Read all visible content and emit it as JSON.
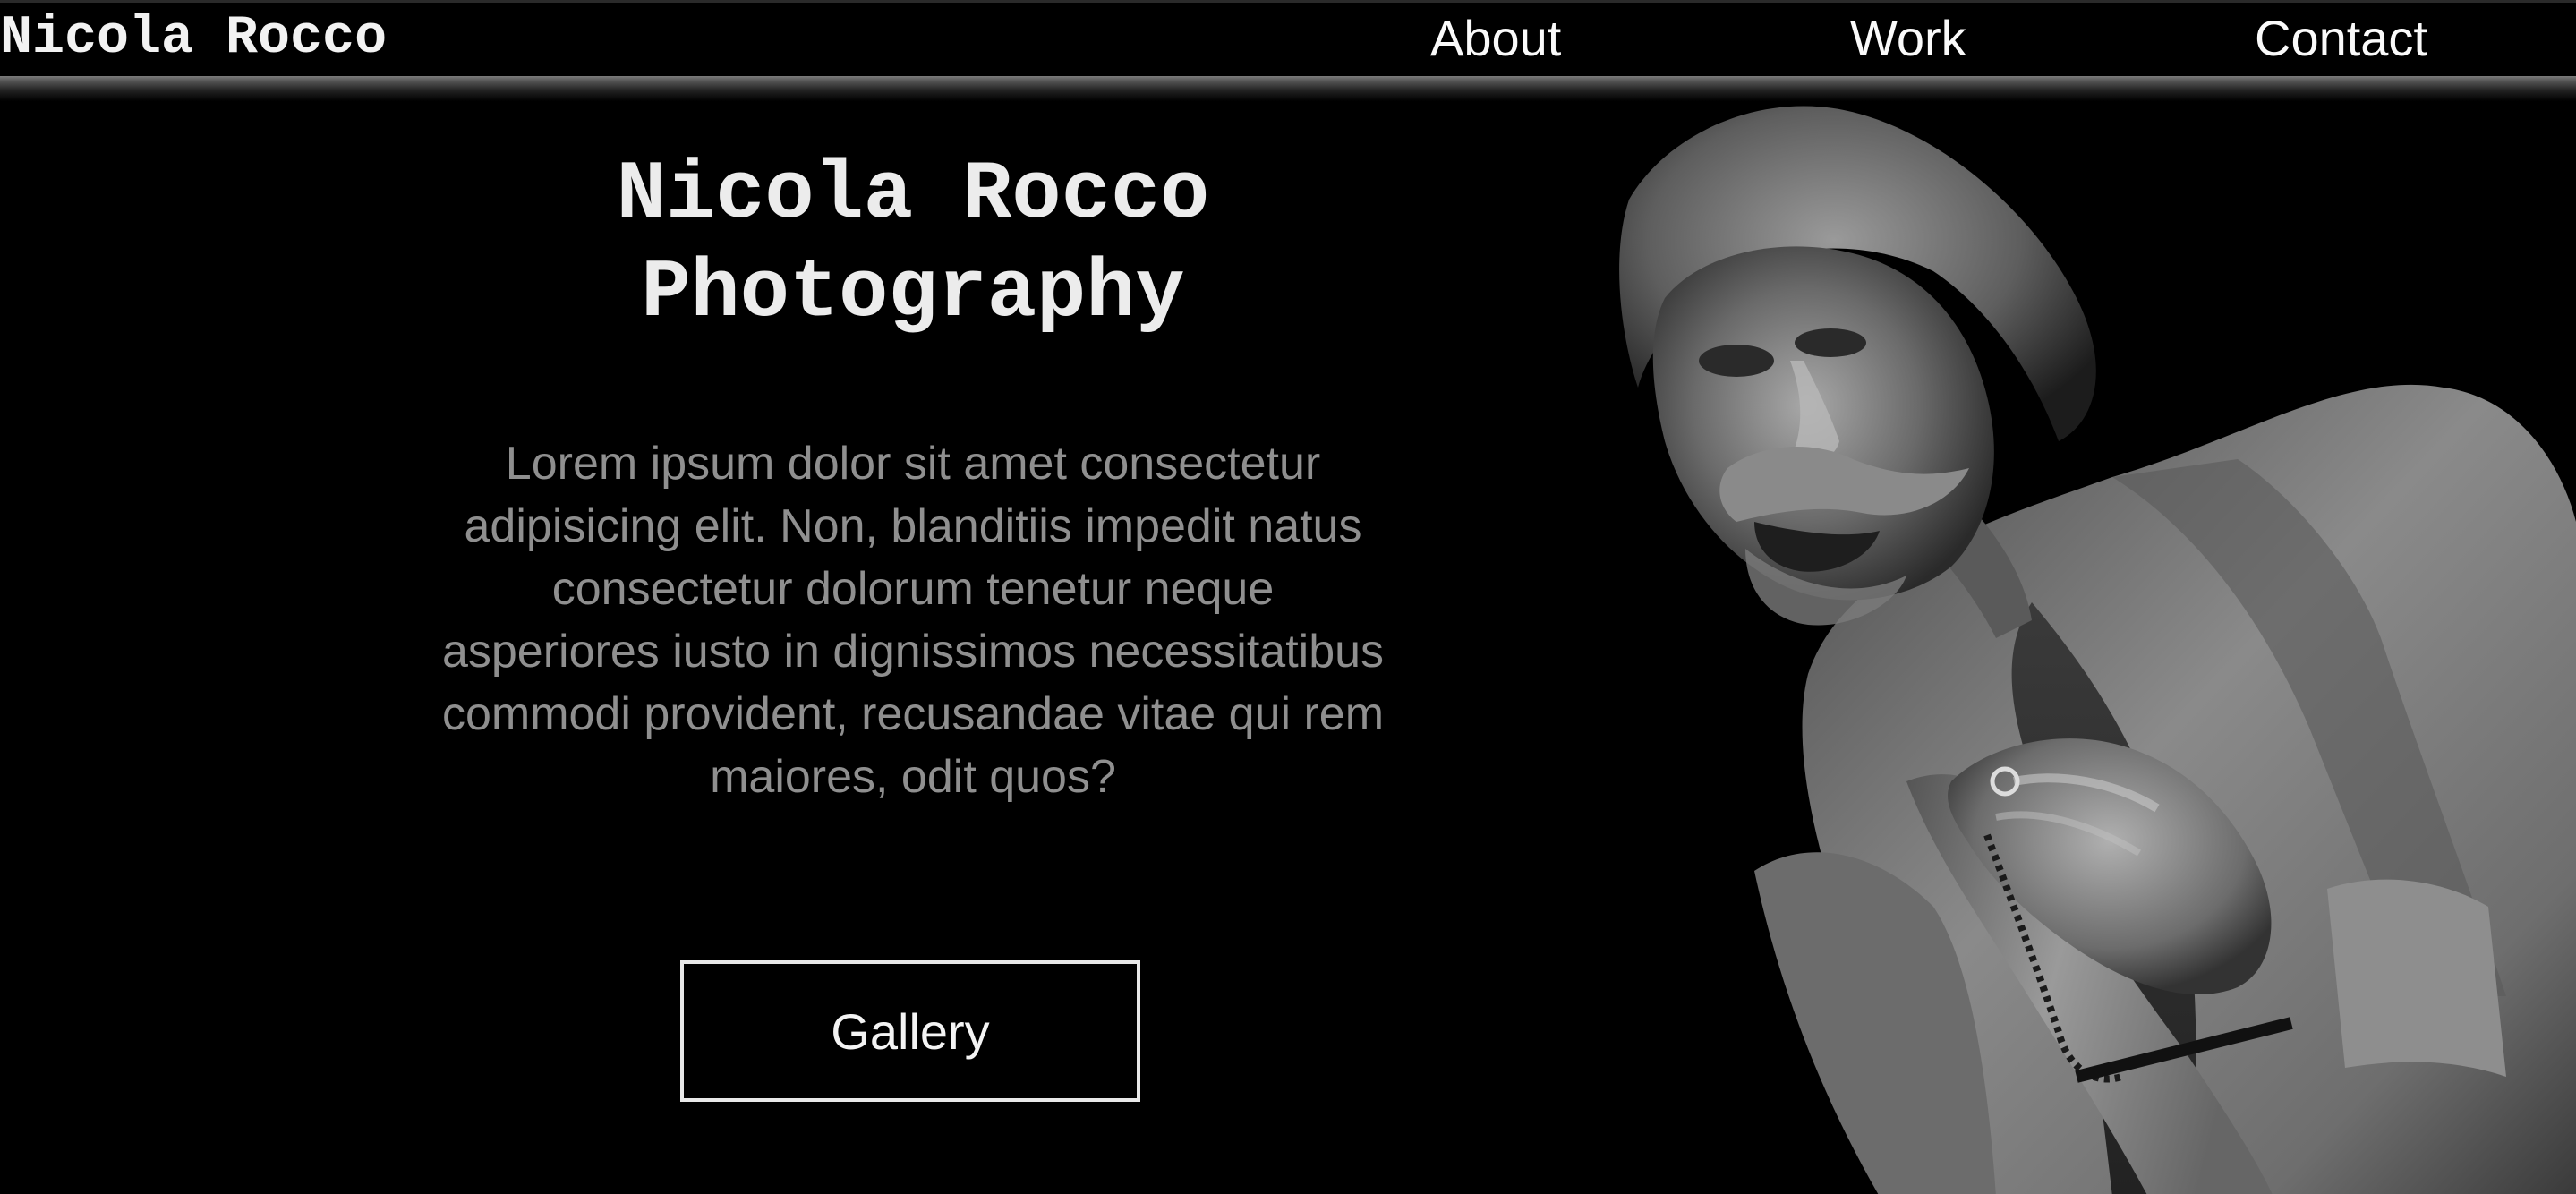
{
  "nav": {
    "brand": "Nicola Rocco",
    "links": [
      {
        "label": "About"
      },
      {
        "label": "Work"
      },
      {
        "label": "Contact"
      }
    ]
  },
  "hero": {
    "title_line1": "Nicola Rocco",
    "title_line2": "Photography",
    "body": "Lorem ipsum dolor sit amet consectetur adipisicing elit. Non, blanditiis impedit natus consectetur dolorum tenetur neque asperiores iusto in dignissimos necessitatibus commodi provident, recusandae vitae qui rem maiores, odit quos?",
    "button_label": "Gallery"
  },
  "colors": {
    "background": "#000000",
    "text_primary": "#f2f2f2",
    "text_muted": "#8f8f8f",
    "button_border": "#e8e8e8"
  },
  "icons": {
    "portrait": "portrait-photo"
  }
}
